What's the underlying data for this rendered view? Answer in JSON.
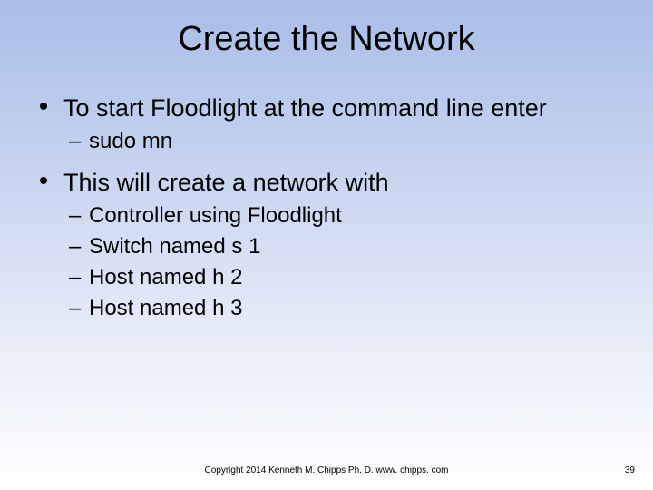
{
  "title": "Create the Network",
  "bullets": {
    "b1": "To start Floodlight at the command line enter",
    "b1_1": "sudo mn",
    "b2": "This will create a network with",
    "b2_1": "Controller using Floodlight",
    "b2_2": "Switch named s 1",
    "b2_3": "Host named h 2",
    "b2_4": "Host named h 3"
  },
  "footer": "Copyright 2014 Kenneth M. Chipps Ph. D. www. chipps. com",
  "page": "39"
}
